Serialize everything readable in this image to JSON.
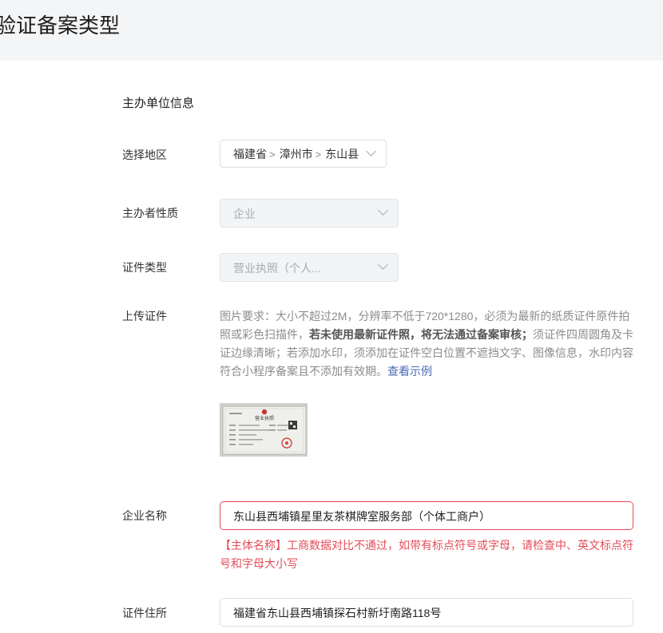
{
  "header": {
    "title": "验证备案类型"
  },
  "section": {
    "title": "主办单位信息"
  },
  "region": {
    "label": "选择地区",
    "province": "福建省",
    "city": "漳州市",
    "county": "东山县"
  },
  "nature": {
    "label": "主办者性质",
    "value": "企业"
  },
  "cert_type": {
    "label": "证件类型",
    "value": "营业执照（个人..."
  },
  "upload": {
    "label": "上传证件",
    "desc_part1": "图片要求：大小不超过2M，分辨率不低于720*1280，必须为最新的纸质证件原件拍照或彩色扫描件，",
    "desc_bold": "若未使用最新证件照，将无法通过备案审核；",
    "desc_part2": "须证件四周圆角及卡证边缘清晰；若添加水印，须添加在证件空白位置不遮挡文字、图像信息，水印内容符合小程序备案且不添加有效期。",
    "example_link": "查看示例",
    "thumbnail_title": "营业执照"
  },
  "company_name": {
    "label": "企业名称",
    "value": "东山县西埔镇星里友茶棋牌室服务部（个体工商户）",
    "error": "【主体名称】工商数据对比不通过，如带有标点符号或字母，请检查中、英文标点符号和字母大小写"
  },
  "address": {
    "label": "证件住所",
    "value": "福建省东山县西埔镇探石村新圩南路118号"
  }
}
